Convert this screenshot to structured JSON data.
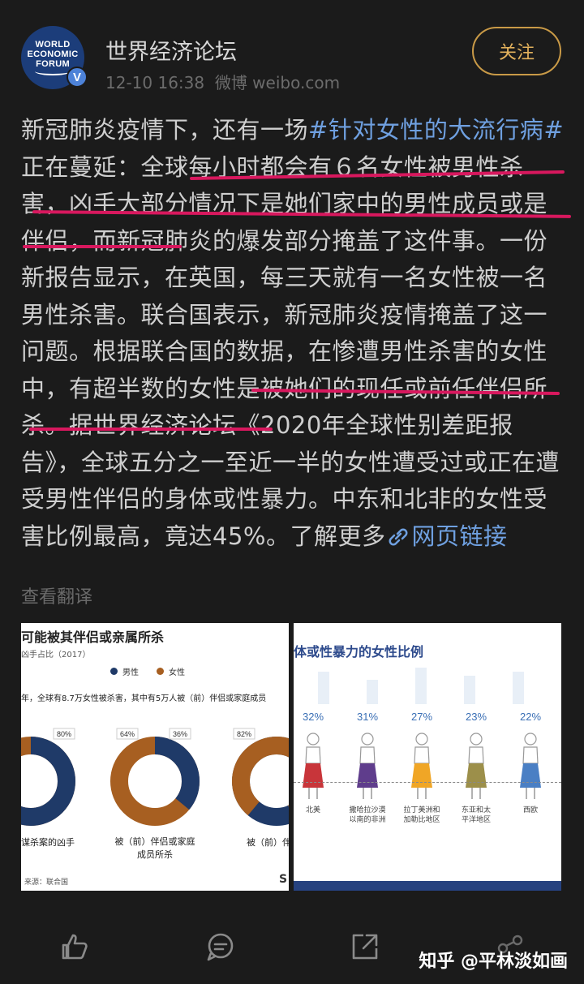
{
  "author": {
    "name": "世界经济论坛",
    "timestamp": "12-10 16:38",
    "source": "微博 weibo.com",
    "avatar_lines": [
      "WORLD",
      "ECONOMIC",
      "FORUM"
    ],
    "verified_mark": "V"
  },
  "follow_label": "关注",
  "post": {
    "p1": "新冠肺炎疫情下，还有一场",
    "tag": "#针对女性的大流行病#",
    "p2": "正在蔓延：全球每小时都会有６名女性被男性杀害，凶手大部分情况下是她们家中的男性成员或是伴侣，而新冠肺炎的爆发部分掩盖了这件事。一份新报告显示，在英国，每三天就有一名女性被一名男性杀害。联合国表示，新冠肺炎疫情掩盖了这一问题。根据联合国的数据，在惨遭男性杀害的女性中，有超半数的女性是被她们的现任或前任伴侣所杀。据世界经济论坛《2020年全球性别差距报告》，全球五分之一至近一半的女性遭受过或正在遭受男性伴侣的身体或性暴力。中东和北非的女性受害比例最高，竟达45%。了解更多",
    "link_label": "网页链接"
  },
  "translate_label": "查看翻译",
  "left_image": {
    "title": "可能被其伴侣或亲属所杀",
    "subtitle": "凶手占比（2017）",
    "legend_male": "男性",
    "legend_female": "女性",
    "note": "年，全球有8.7万女性被杀害，其中有5万人被（前）伴侣或家庭成员",
    "donuts": [
      {
        "male_pct": "80%",
        "label1": "谋杀案的凶手",
        "label2": ""
      },
      {
        "female_pct": "64%",
        "male_pct": "36%",
        "label1": "被（前）伴侣或家庭",
        "label2": "成员所杀"
      },
      {
        "female_pct": "82%",
        "label1": "被（前）伴",
        "label2": ""
      }
    ],
    "source": "来源：联合国",
    "corner": "S",
    "colors": {
      "male": "#1f3a68",
      "female": "#a75f21"
    }
  },
  "right_image": {
    "title": "体或性暴力的女性比例",
    "figures": [
      {
        "pct": "32%",
        "region": "北美",
        "region2": "",
        "color": "#c8353a"
      },
      {
        "pct": "31%",
        "region": "撒哈拉沙漠",
        "region2": "以南的非洲",
        "color": "#5f3d8c"
      },
      {
        "pct": "27%",
        "region": "拉丁美洲和",
        "region2": "加勒比地区",
        "color": "#f0a626"
      },
      {
        "pct": "23%",
        "region": "东亚和太",
        "region2": "平洋地区",
        "color": "#9c8f4a"
      },
      {
        "pct": "22%",
        "region": "西欧",
        "region2": "",
        "color": "#4a7fc4"
      }
    ]
  },
  "actions": [
    "like-icon",
    "comment-icon",
    "share-icon",
    "more-icon"
  ],
  "watermark": "知乎 @平林淡如画"
}
